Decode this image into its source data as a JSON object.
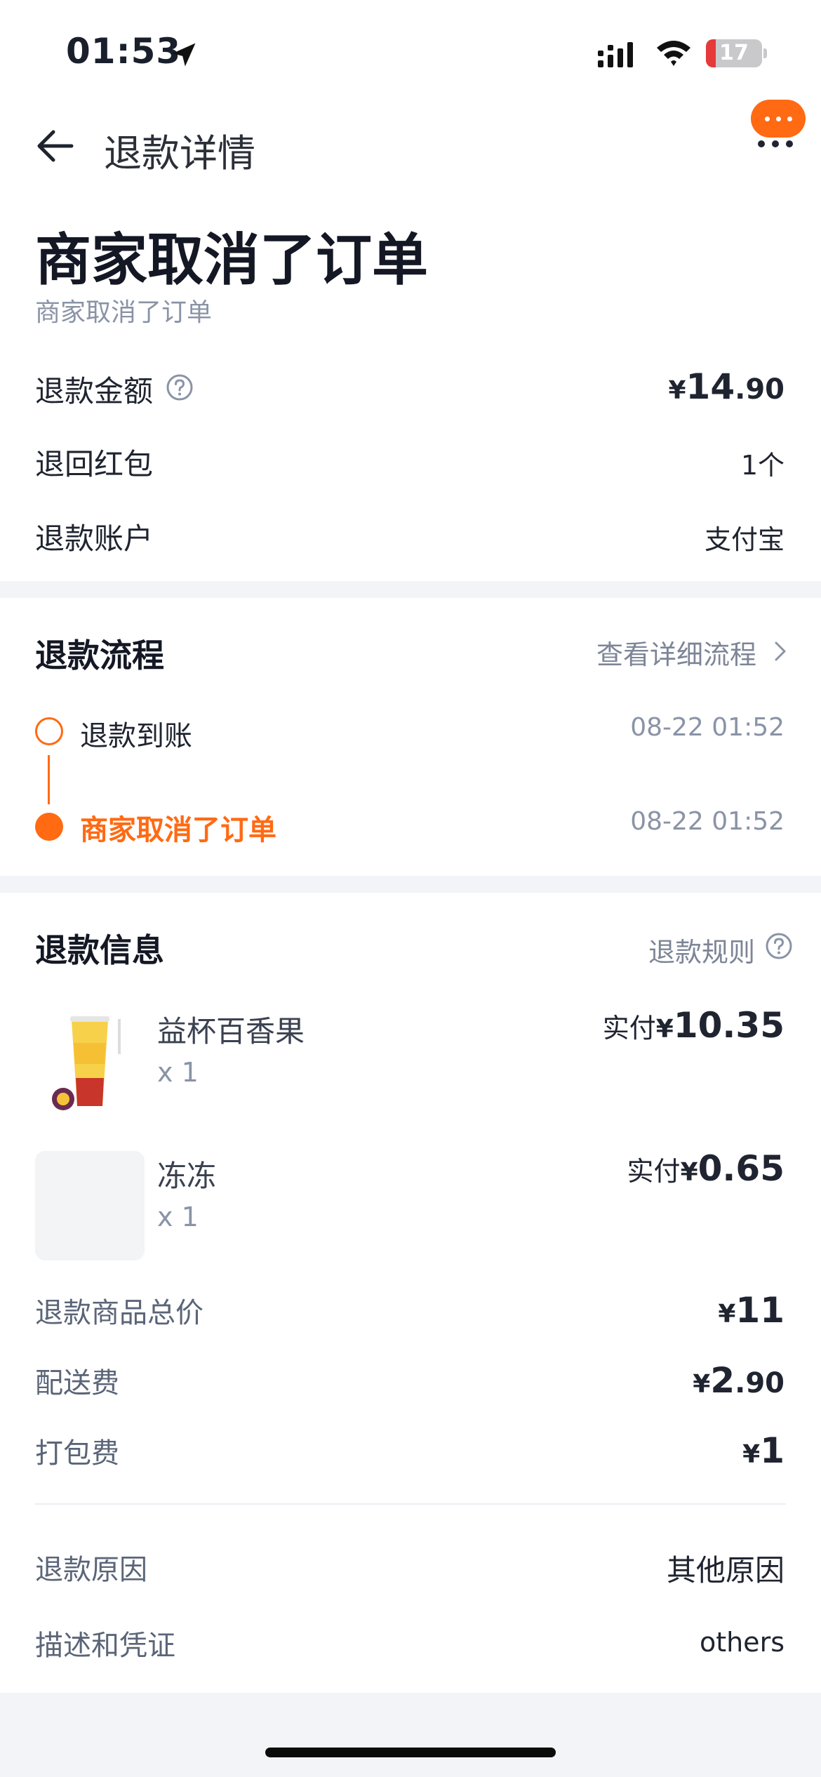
{
  "status_bar": {
    "time": "01:53",
    "battery_level": "17",
    "battery_fraction": 0.17,
    "icons": [
      "location-arrow-icon",
      "signal-icon",
      "wifi-icon",
      "battery-icon"
    ]
  },
  "header": {
    "title": "退款详情",
    "back_icon": "arrow-left-icon",
    "service_icon": "chat-bubble-icon",
    "more_icon": "more-dots-icon"
  },
  "summary": {
    "title": "商家取消了订单",
    "subtitle": "商家取消了订单",
    "rows": {
      "amount": {
        "label": "退款金额",
        "currency": "¥",
        "integer": "14",
        "decimal": ".90"
      },
      "red_packet": {
        "label": "退回红包",
        "value": "1个"
      },
      "account": {
        "label": "退款账户",
        "value": "支付宝"
      }
    }
  },
  "process": {
    "title": "退款流程",
    "detail_link": "查看详细流程",
    "steps": [
      {
        "label": "退款到账",
        "time": "08-22 01:52",
        "active": false
      },
      {
        "label": "商家取消了订单",
        "time": "08-22 01:52",
        "active": true
      }
    ]
  },
  "info": {
    "title": "退款信息",
    "rules_link": "退款规则",
    "products": [
      {
        "name": "益杯百香果",
        "qty": "x 1",
        "paid_label": "实付",
        "currency": "¥",
        "integer": "10",
        "decimal": ".35"
      },
      {
        "name": "冻冻",
        "qty": "x 1",
        "paid_label": "实付",
        "currency": "¥",
        "integer": "0",
        "decimal": ".65"
      }
    ],
    "totals": {
      "goods_total": {
        "label": "退款商品总价",
        "currency": "¥",
        "integer": "11",
        "decimal": ""
      },
      "delivery_fee": {
        "label": "配送费",
        "currency": "¥",
        "integer": "2",
        "decimal": ".90"
      },
      "packing_fee": {
        "label": "打包费",
        "currency": "¥",
        "integer": "1",
        "decimal": ""
      }
    },
    "reason": {
      "label": "退款原因",
      "value": "其他原因"
    },
    "description": {
      "label": "描述和凭证",
      "value": "others"
    }
  },
  "colors": {
    "accent": "#ff6a13",
    "text_primary": "#141824",
    "text_secondary": "#8a93a6",
    "background": "#f2f4f7"
  }
}
